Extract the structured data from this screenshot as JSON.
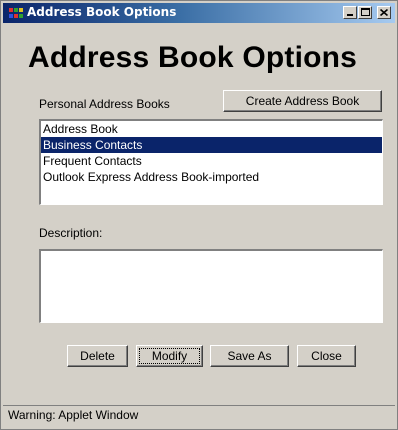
{
  "window": {
    "title": "Address Book Options"
  },
  "titlebar_buttons": {
    "minimize_icon": "minimize-icon",
    "maximize_icon": "maximize-icon",
    "close_icon": "close-icon"
  },
  "main": {
    "heading": "Address Book Options",
    "personal_label": "Personal Address Books",
    "create_button": "Create Address Book",
    "address_books": [
      {
        "label": "Address Book",
        "selected": false
      },
      {
        "label": "Business Contacts",
        "selected": true
      },
      {
        "label": "Frequent Contacts",
        "selected": false
      },
      {
        "label": "Outlook Express Address Book-imported",
        "selected": false
      }
    ],
    "description_label": "Description:",
    "description_value": ""
  },
  "buttons": {
    "delete": "Delete",
    "modify": "Modify",
    "save_as": "Save As",
    "close": "Close"
  },
  "status": {
    "text": "Warning: Applet Window"
  },
  "colors": {
    "window_bg": "#d4d0c8",
    "title_bar": "#0a246a",
    "selection": "#0a246a"
  }
}
